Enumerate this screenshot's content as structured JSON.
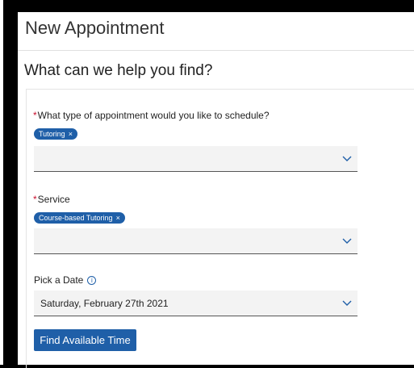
{
  "page": {
    "title": "New Appointment",
    "heading": "What can we help you find?"
  },
  "appointment_type": {
    "label": "What type of appointment would you like to schedule?",
    "required_mark": "*",
    "chip": "Tutoring",
    "chip_remove": "×",
    "value": ""
  },
  "service": {
    "label": "Service",
    "required_mark": "*",
    "chip": "Course-based Tutoring",
    "chip_remove": "×",
    "value": ""
  },
  "date": {
    "label": "Pick a Date",
    "info_glyph": "i",
    "value": "Saturday, February 27th 2021"
  },
  "actions": {
    "find_label": "Find Available Time"
  },
  "colors": {
    "accent": "#1f5fa8",
    "required": "#c8102e"
  },
  "icons": {
    "dropdown": "chevron-down-icon",
    "info": "info-icon",
    "remove": "close-icon"
  }
}
